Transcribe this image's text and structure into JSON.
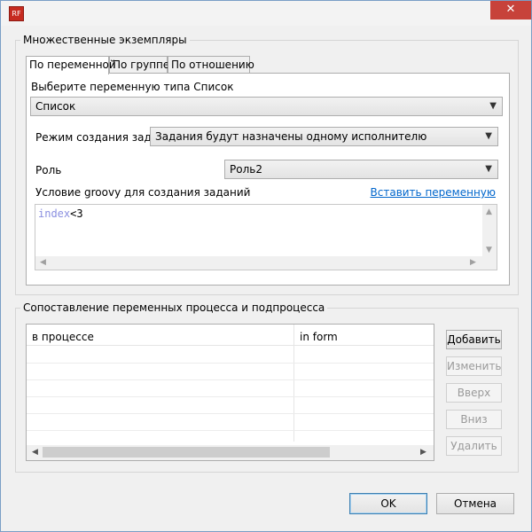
{
  "window": {
    "app_icon": "app-logo-icon",
    "close_glyph": "✕"
  },
  "multiple_instances": {
    "title": "Множественные экземпляры",
    "tabs": [
      {
        "label": "По переменной",
        "active": true
      },
      {
        "label": "По группе",
        "active": false
      },
      {
        "label": "По отношению",
        "active": false
      }
    ],
    "list_variable_label": "Выберите переменную типа Список",
    "list_variable_value": "Список",
    "task_mode_label": "Режим создания задач",
    "task_mode_value": "Задания будут назначены одному исполнителю",
    "role_label": "Роль",
    "role_value": "Роль2",
    "groovy_label": "Условие groovy для создания заданий",
    "insert_variable_link": "Вставить переменную",
    "groovy_code_keyword": "index",
    "groovy_code_rest": "<3"
  },
  "mapping": {
    "title": "Сопоставление переменных процесса и подпроцесса",
    "columns": [
      "в процессе",
      "in form"
    ],
    "buttons": {
      "add": "Добавить",
      "edit": "Изменить",
      "up": "Вверх",
      "down": "Вниз",
      "delete": "Удалить"
    }
  },
  "footer": {
    "ok": "OK",
    "cancel": "Отмена"
  },
  "colors": {
    "link": "#0066cc",
    "close_button": "#c7423a",
    "code_keyword": "#8a8fe0"
  }
}
